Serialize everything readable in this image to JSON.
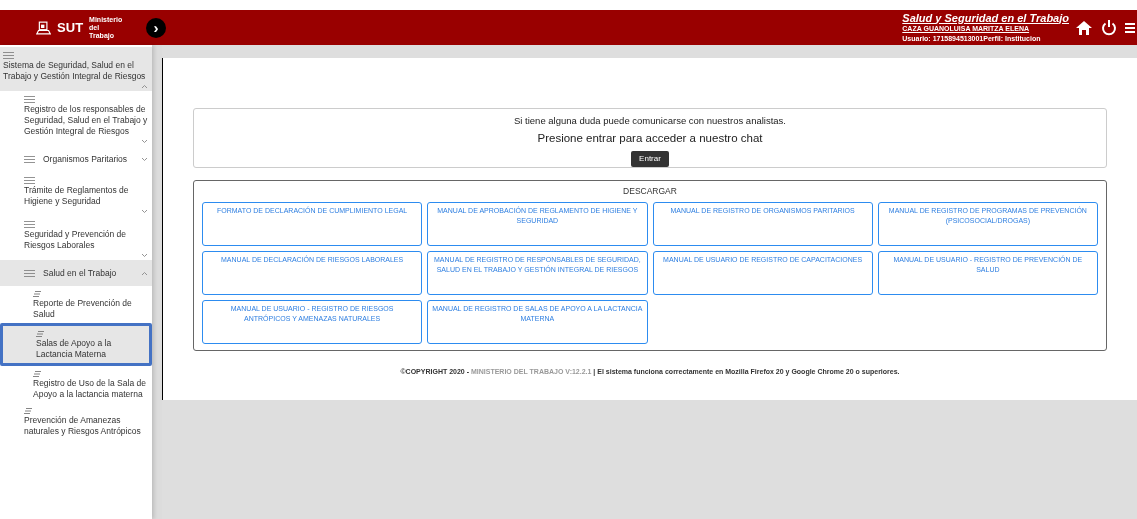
{
  "header": {
    "logo_text": "SUT",
    "ministry": "Ministerio del Trabajo",
    "toggle": "›",
    "title": "Salud y Seguridad en el Trabajo",
    "user_name": "CAZA GUANOLUISA MARITZA ELENA",
    "user_info": "Usuario: 1715894513001Perfil: Institucion"
  },
  "sidebar": {
    "items": [
      {
        "label": "Sistema de Seguridad, Salud en el Trabajo y Gestión Integral de Riesgos",
        "kind": "stacked",
        "expanded": true,
        "children": [
          {
            "label": "Registro de los responsables de Seguridad, Salud en el Trabajo y Gestión Integral de Riesgos",
            "kind": "stacked",
            "expanded": false
          },
          {
            "label": "Organismos Paritarios",
            "kind": "inline",
            "expanded": false
          },
          {
            "label": "Trámite de Reglamentos de Higiene y Seguridad",
            "kind": "stacked",
            "expanded": false
          },
          {
            "label": "Seguridad y Prevención de Riesgos Laborales",
            "kind": "stacked",
            "expanded": false
          },
          {
            "label": "Salud en el Trabajo",
            "kind": "inline",
            "expanded": true,
            "children": [
              {
                "label": "Reporte de Prevención de Salud",
                "kind": "leaf",
                "selected": false
              },
              {
                "label": "Salas de Apoyo a la Lactancia Materna",
                "kind": "leaf",
                "selected": true
              },
              {
                "label": "Registro de Uso de la Sala de Apoyo a la lactancia materna",
                "kind": "leaf",
                "selected": false
              }
            ]
          },
          {
            "label": "Prevención de Amanezas naturales y Riesgos Antrópicos",
            "kind": "leaf",
            "selected": false
          }
        ]
      }
    ]
  },
  "chat": {
    "message": "Si tiene alguna duda puede comunicarse con nuestros analistas.",
    "prompt": "Presione entrar para acceder a nuestro chat",
    "button": "Entrar"
  },
  "downloads": {
    "title": "DESCARGAR",
    "links": [
      "FORMATO DE DECLARACIÓN DE CUMPLIMIENTO LEGAL",
      "MANUAL DE APROBACIÓN DE REGLAMENTO DE HIGIENE Y SEGURIDAD",
      "MANUAL DE REGISTRO DE ORGANISMOS PARITARIOS",
      "MANUAL DE REGISTRO DE PROGRAMAS DE PREVENCIÓN (PSICOSOCIAL/DROGAS)",
      "MANUAL DE DECLARACIÓN DE RIESGOS LABORALES",
      "MANUAL DE REGISTRO DE RESPONSABLES DE SEGURIDAD, SALUD EN EL TRABAJO Y GESTIÓN INTEGRAL DE RIESGOS",
      "MANUAL DE USUARIO DE REGISTRO DE CAPACITACIONES",
      "MANUAL DE USUARIO - REGISTRO DE PREVENCIÓN DE SALUD",
      "MANUAL DE USUARIO - REGISTRO DE RIESGOS ANTRÓPICOS Y AMENAZAS NATURALES",
      "MANUAL DE REGISTRO DE SALAS DE APOYO A LA LACTANCIA MATERNA"
    ]
  },
  "footer": [
    {
      "text": "©COPYRIGHT 2020 - ",
      "kind": "strong"
    },
    {
      "text": "MINISTERIO DEL TRABAJO V:12.2.1",
      "kind": "muted"
    },
    {
      "text": " | El sistema funciona correctamente en Mozilla Firefox 20 y Google Chrome 20 o superiores.",
      "kind": "strong"
    }
  ]
}
